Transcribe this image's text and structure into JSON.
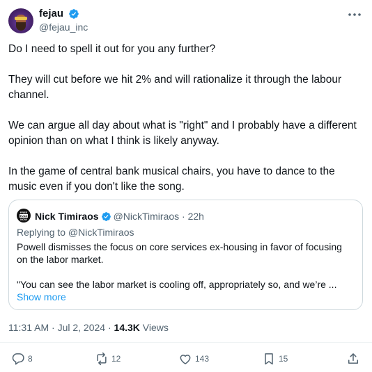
{
  "author": {
    "display_name": "fejau",
    "handle": "@fejau_inc"
  },
  "tweet": {
    "paragraphs": [
      "Do I need to spell it out for you any further?",
      "They will cut before we hit 2% and will rationalize it through the labour channel.",
      "We can argue all day about what is \"right\" and I probably have a different opinion than on what I think is likely anyway.",
      "In the game of central bank musical chairs, you have to dance to the music even if you don't like the song."
    ]
  },
  "quote": {
    "avatar_text_top": "FREE",
    "avatar_text_mid": "EVAN",
    "avatar_text_bottom": "NOW",
    "display_name": "Nick Timiraos",
    "handle": "@NickTimiraos",
    "separator": "·",
    "time": "22h",
    "replying_to": "Replying to @NickTimiraos",
    "paragraphs": [
      "Powell dismisses the focus on core services ex-housing in favor of focusing on the labor market.",
      "\"You can see the labor market is cooling off, appropriately so, and we’re ..."
    ],
    "show_more": "Show more"
  },
  "meta": {
    "time": "11:31 AM",
    "separator": "·",
    "date": "Jul 2, 2024",
    "views_count": "14.3K",
    "views_label": "Views"
  },
  "actions": {
    "replies": "8",
    "reposts": "12",
    "likes": "143",
    "bookmarks": "15"
  },
  "colors": {
    "accent": "#1d9bf0",
    "secondary_text": "#536471",
    "border": "#cfd9de"
  },
  "icons": [
    "verified-badge-icon",
    "more-icon",
    "reply-icon",
    "repost-icon",
    "like-icon",
    "bookmark-icon",
    "share-icon"
  ]
}
